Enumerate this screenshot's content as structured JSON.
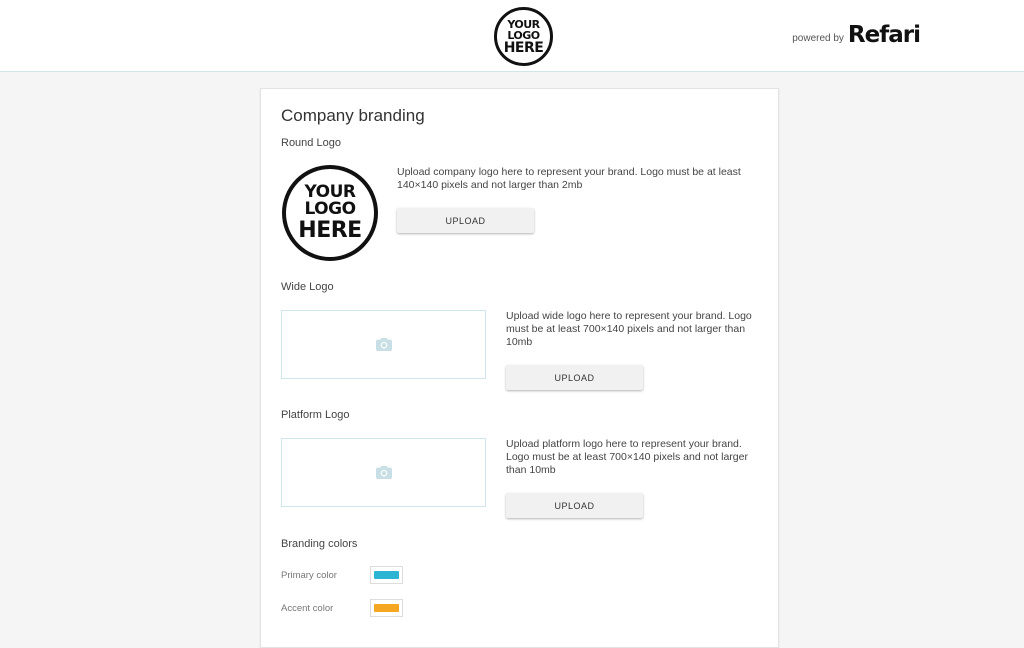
{
  "header": {
    "logo_lines": [
      "YOUR",
      "LOGO",
      "HERE"
    ],
    "powered_by": "powered by",
    "brand": "Refari"
  },
  "card": {
    "title": "Company branding",
    "round_logo": {
      "label": "Round Logo",
      "logo_lines": [
        "YOUR",
        "LOGO",
        "HERE"
      ],
      "description": "Upload company logo here to represent your brand. Logo must be at least 140×140 pixels and not larger than 2mb",
      "button": "UPLOAD"
    },
    "wide_logo": {
      "label": "Wide Logo",
      "placeholder_icon": "camera-icon",
      "description": "Upload wide logo here to represent your brand. Logo must be at least 700×140 pixels and not larger than 10mb",
      "button": "UPLOAD"
    },
    "platform_logo": {
      "label": "Platform Logo",
      "placeholder_icon": "camera-icon",
      "description": "Upload platform logo here to represent your brand. Logo must be at least 700×140 pixels and not larger than 10mb",
      "button": "UPLOAD"
    },
    "branding_colors": {
      "label": "Branding colors",
      "primary": {
        "label": "Primary color",
        "value": "#2bb5d3"
      },
      "accent": {
        "label": "Accent color",
        "value": "#f5a623"
      }
    }
  },
  "colors": {
    "border_accent": "#cfe6ea",
    "icon": "#c9dfe6"
  }
}
